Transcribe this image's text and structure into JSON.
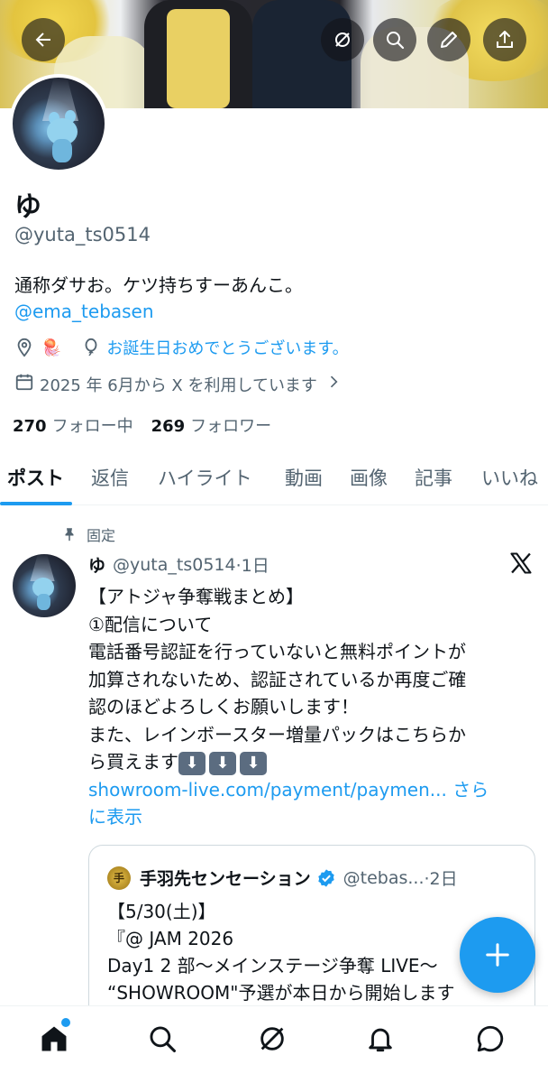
{
  "profile": {
    "name": "ゆ",
    "handle": "@yuta_ts0514",
    "bio": "通称ダサお。ケツ持ちすーあんこ。",
    "bio_link": "@ema_tebasen",
    "location_emoji": "🪼",
    "birthday_text": "お誕生日おめでとうございます。",
    "joined_text": "2025 年 6月から X を利用しています",
    "following_count": "270",
    "following_label": "フォロー中",
    "followers_count": "269",
    "followers_label": "フォロワー"
  },
  "tabs": [
    {
      "label": "ポスト"
    },
    {
      "label": "返信"
    },
    {
      "label": "ハイライト"
    },
    {
      "label": "動画"
    },
    {
      "label": "画像"
    },
    {
      "label": "記事"
    },
    {
      "label": "いいね"
    }
  ],
  "post": {
    "pinned_label": "固定",
    "author_name": "ゆ",
    "author_handle": "@yuta_ts0514",
    "time": "·1日",
    "lines": [
      "【アトジャ争奪戦まとめ】",
      "①配信について",
      "電話番号認証を行っていないと無料ポイントが",
      "加算されないため、認証されているか再度ご確",
      "認のほどよろしくお願いします！",
      "また、レインボースター増量パックはこちらか"
    ],
    "last_line_text": "ら買えます",
    "arrow_emoji": "⬇️",
    "link_text": "showroom-live.com/payment/paymen...",
    "more_label_1": "さら",
    "more_label_2": "に表示"
  },
  "quote": {
    "author_name": "手羽先センセーション",
    "author_handle": "@tebas...",
    "time": "·2日",
    "lines": [
      "【5/30(土)】",
      "『@ JAM 2026",
      "Day1  2 部〜メインステージ争奪 LIVE〜",
      "“SHOWROOM\"予選が本日から開始します"
    ]
  },
  "colors": {
    "accent": "#1d9bf0",
    "text": "#0f1419",
    "secondary": "#536471"
  },
  "icons": {
    "banner_buttons": [
      "back-arrow-icon",
      "grok-icon",
      "search-icon",
      "edit-pencil-icon",
      "share-icon"
    ],
    "bottom_nav": [
      "home-icon",
      "search-icon",
      "grok-icon",
      "notifications-bell-icon",
      "messages-icon"
    ]
  }
}
